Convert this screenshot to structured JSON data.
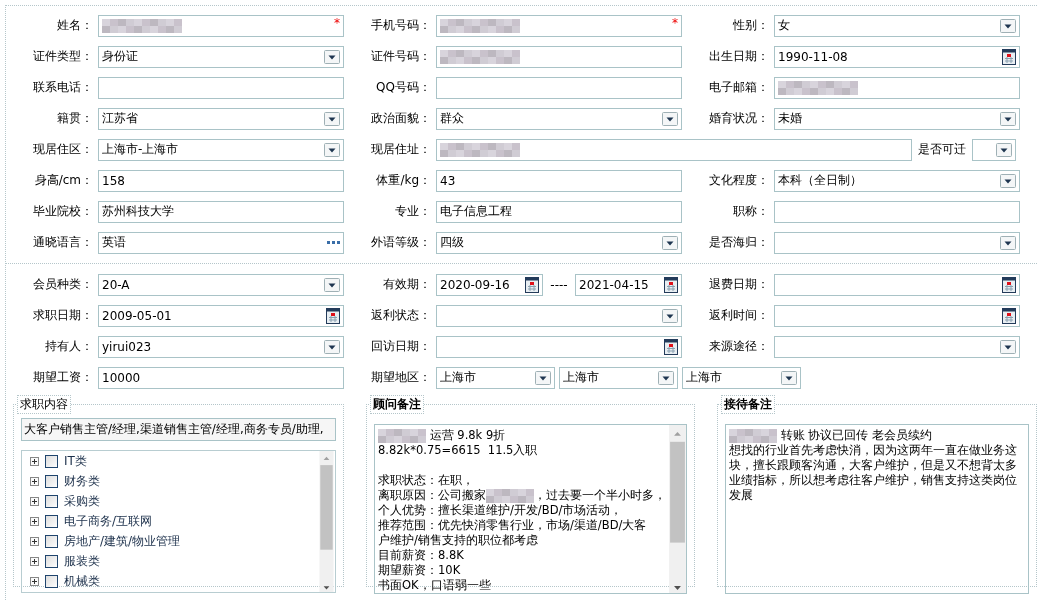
{
  "sections": [
    {
      "rows": [
        {
          "items": [
            {
              "label": "姓名：",
              "fields": [
                {
                  "kind": "text",
                  "redacted": true,
                  "mark": "*"
                }
              ]
            },
            {
              "label": "手机号码：",
              "fields": [
                {
                  "kind": "text",
                  "redacted": true,
                  "mark": "*"
                }
              ]
            },
            {
              "label": "性别：",
              "fields": [
                {
                  "kind": "select",
                  "value": "女"
                }
              ]
            }
          ]
        },
        {
          "items": [
            {
              "label": "证件类型：",
              "fields": [
                {
                  "kind": "select",
                  "value": "身份证"
                }
              ]
            },
            {
              "label": "证件号码：",
              "fields": [
                {
                  "kind": "text",
                  "redacted": true
                }
              ]
            },
            {
              "label": "出生日期：",
              "fields": [
                {
                  "kind": "date",
                  "value": "1990-11-08"
                }
              ]
            }
          ]
        },
        {
          "items": [
            {
              "label": "联系电话：",
              "fields": [
                {
                  "kind": "text"
                }
              ]
            },
            {
              "label": "QQ号码：",
              "fields": [
                {
                  "kind": "text"
                }
              ]
            },
            {
              "label": "电子邮箱：",
              "fields": [
                {
                  "kind": "text",
                  "redacted": true
                }
              ]
            }
          ]
        },
        {
          "items": [
            {
              "label": "籍贯：",
              "fields": [
                {
                  "kind": "select",
                  "value": "江苏省"
                }
              ]
            },
            {
              "label": "政治面貌：",
              "fields": [
                {
                  "kind": "select",
                  "value": "群众"
                }
              ]
            },
            {
              "label": "婚育状况：",
              "fields": [
                {
                  "kind": "select",
                  "value": "未婚"
                }
              ]
            }
          ]
        },
        {
          "items": [
            {
              "label": "现居住区：",
              "fields": [
                {
                  "kind": "select",
                  "value": "上海市-上海市"
                }
              ]
            },
            {
              "label": "现居住址：",
              "wide": true,
              "fields": [
                {
                  "kind": "text",
                  "redacted": true
                }
              ]
            },
            {
              "label": "是否可迁",
              "compact": true,
              "fields": [
                {
                  "kind": "select"
                }
              ]
            }
          ]
        },
        {
          "items": [
            {
              "label": "身高/cm：",
              "fields": [
                {
                  "kind": "text",
                  "value": "158"
                }
              ]
            },
            {
              "label": "体重/kg：",
              "fields": [
                {
                  "kind": "text",
                  "value": "43"
                }
              ]
            },
            {
              "label": "文化程度：",
              "fields": [
                {
                  "kind": "select",
                  "value": "本科（全日制）"
                }
              ]
            }
          ]
        },
        {
          "items": [
            {
              "label": "毕业院校：",
              "fields": [
                {
                  "kind": "text",
                  "value": "苏州科技大学"
                }
              ]
            },
            {
              "label": "专业：",
              "fields": [
                {
                  "kind": "text",
                  "value": "电子信息工程"
                }
              ]
            },
            {
              "label": "职称：",
              "fields": [
                {
                  "kind": "text"
                }
              ]
            }
          ]
        },
        {
          "items": [
            {
              "label": "通晓语言：",
              "fields": [
                {
                  "kind": "lookup",
                  "value": "英语"
                }
              ]
            },
            {
              "label": "外语等级：",
              "fields": [
                {
                  "kind": "select",
                  "value": "四级"
                }
              ]
            },
            {
              "label": "是否海归：",
              "fields": [
                {
                  "kind": "select"
                }
              ]
            }
          ]
        }
      ]
    },
    {
      "rows": [
        {
          "items": [
            {
              "label": "会员种类：",
              "fields": [
                {
                  "kind": "select",
                  "value": "20-A"
                }
              ]
            },
            {
              "label": "有效期：",
              "separator": "----",
              "fields": [
                {
                  "kind": "date",
                  "value": "2020-09-16"
                },
                {
                  "kind": "date",
                  "value": "2021-04-15"
                }
              ]
            },
            {
              "label": "退费日期：",
              "fields": [
                {
                  "kind": "date"
                }
              ]
            }
          ]
        },
        {
          "items": [
            {
              "label": "求职日期：",
              "fields": [
                {
                  "kind": "date",
                  "value": "2009-05-01"
                }
              ]
            },
            {
              "label": "返利状态：",
              "fields": [
                {
                  "kind": "select"
                }
              ]
            },
            {
              "label": "返利时间：",
              "fields": [
                {
                  "kind": "date"
                }
              ]
            }
          ]
        },
        {
          "items": [
            {
              "label": "持有人：",
              "fields": [
                {
                  "kind": "select",
                  "value": "yirui023"
                }
              ]
            },
            {
              "label": "回访日期：",
              "fields": [
                {
                  "kind": "date"
                }
              ]
            },
            {
              "label": "来源途径：",
              "fields": [
                {
                  "kind": "select"
                }
              ]
            }
          ]
        },
        {
          "items": [
            {
              "label": "期望工资：",
              "fields": [
                {
                  "kind": "text",
                  "value": "10000"
                }
              ]
            },
            {
              "label": "期望地区：",
              "fields": [
                {
                  "kind": "select",
                  "value": "上海市"
                },
                {
                  "kind": "select",
                  "value": "上海市"
                },
                {
                  "kind": "select",
                  "value": "上海市"
                }
              ]
            }
          ]
        }
      ]
    }
  ],
  "panels": [
    {
      "kind": "tree",
      "title": "求职内容",
      "emphasized": false,
      "selection": "大客户销售主管/经理,渠道销售主管/经理,商务专员/助理,",
      "tree": [
        {
          "label": "IT类",
          "expanded": false,
          "checked": false
        },
        {
          "label": "财务类",
          "expanded": false,
          "checked": false
        },
        {
          "label": "采购类",
          "expanded": false,
          "checked": false
        },
        {
          "label": "电子商务/互联网",
          "expanded": false,
          "checked": false
        },
        {
          "label": "房地产/建筑/物业管理",
          "expanded": false,
          "checked": false
        },
        {
          "label": "服装类",
          "expanded": false,
          "checked": false
        },
        {
          "label": "机械类",
          "expanded": false,
          "checked": false
        }
      ]
    },
    {
      "kind": "notes",
      "title": "顾问备注",
      "emphasized": true,
      "scrollable": true,
      "lines": [
        {
          "segments": [
            {
              "kind": "mosaic"
            },
            {
              "kind": "text",
              "text": " 运营 9.8k 9折"
            }
          ]
        },
        {
          "segments": [
            {
              "kind": "text",
              "text": "8.82k*0.75=6615  11.5入职"
            }
          ]
        },
        {
          "kind": "blank"
        },
        {
          "segments": [
            {
              "kind": "text",
              "text": "求职状态：在职，"
            }
          ]
        },
        {
          "segments": [
            {
              "kind": "text",
              "text": "离职原因：公司搬家"
            },
            {
              "kind": "mosaic"
            },
            {
              "kind": "text",
              "text": "，过去要一个半小时多，"
            }
          ]
        },
        {
          "segments": [
            {
              "kind": "text",
              "text": "个人优势：擅长渠道维护/开发/BD/市场活动，"
            }
          ]
        },
        {
          "segments": [
            {
              "kind": "text",
              "text": "推荐范围：优先快消零售行业，市场/渠道/BD/大客"
            }
          ]
        },
        {
          "segments": [
            {
              "kind": "text",
              "text": "户维护/销售支持的职位都考虑"
            }
          ]
        },
        {
          "segments": [
            {
              "kind": "text",
              "text": "目前薪资：8.8K"
            }
          ]
        },
        {
          "segments": [
            {
              "kind": "text",
              "text": "期望薪资：10K"
            }
          ]
        },
        {
          "segments": [
            {
              "kind": "text",
              "text": "书面OK，口语弱一些"
            }
          ]
        }
      ]
    },
    {
      "kind": "notes",
      "title": "接待备注",
      "emphasized": true,
      "scrollable": false,
      "lines": [
        {
          "segments": [
            {
              "kind": "mosaic"
            },
            {
              "kind": "text",
              "text": " 转账 协议已回传 老会员续约"
            }
          ]
        },
        {
          "segments": [
            {
              "kind": "text",
              "text": "想找的行业首先考虑快消，因为这两年一直在做业务这"
            }
          ]
        },
        {
          "segments": [
            {
              "kind": "text",
              "text": "块，擅长跟顾客沟通，大客户维护，但是又不想背太多"
            }
          ]
        },
        {
          "segments": [
            {
              "kind": "text",
              "text": "业绩指标，所以想考虑往客户维护，销售支持这类岗位"
            }
          ]
        },
        {
          "segments": [
            {
              "kind": "text",
              "text": "发展"
            }
          ]
        }
      ]
    }
  ]
}
